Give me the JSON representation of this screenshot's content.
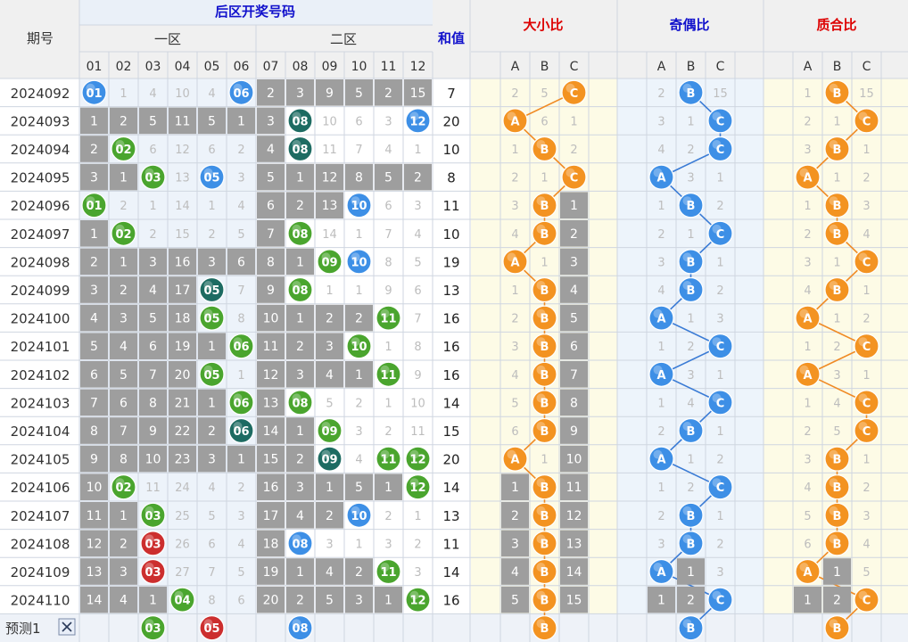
{
  "header": {
    "period_label": "期号",
    "back_zone_title": "后区开奖号码",
    "zone1_label": "一区",
    "zone2_label": "二区",
    "sum_label": "和值",
    "ratio_titles": [
      "大小比",
      "奇偶比",
      "质合比"
    ],
    "columns": [
      "01",
      "02",
      "03",
      "04",
      "05",
      "06",
      "07",
      "08",
      "09",
      "10",
      "11",
      "12"
    ],
    "ratio_sub": [
      "A",
      "B",
      "C"
    ]
  },
  "predict": {
    "label": "预测1",
    "close_icon": "close-x-icon",
    "balls": [
      {
        "col": 3,
        "text": "03",
        "color": "green"
      },
      {
        "col": 5,
        "text": "05",
        "color": "red"
      },
      {
        "col": 8,
        "text": "08",
        "color": "blue"
      }
    ],
    "ratio_balls": [
      {
        "group": 0,
        "col": "B"
      },
      {
        "group": 1,
        "col": "B"
      },
      {
        "group": 2,
        "col": "B"
      }
    ]
  },
  "colors": {
    "blue_ball": "#3d8fe6",
    "green_ball": "#4aa52e",
    "teal_ball": "#1d6b62",
    "red_ball": "#cc2e2e",
    "orange_ball": "#f39321",
    "gray_cell": "#9e9e9e",
    "line_blue": "#3a7bd5",
    "line_orange": "#f08a24"
  },
  "chart_data": {
    "type": "table",
    "rows": [
      {
        "period": "2024092",
        "cells": [
          "01",
          "1",
          "4",
          "10",
          "4",
          "06",
          "2",
          "3",
          "9",
          "5",
          "2",
          "15"
        ],
        "sum": "7",
        "ratios": [
          [
            "2",
            "5",
            "C"
          ],
          [
            "2",
            "B",
            "15"
          ],
          [
            "1",
            "B",
            "15"
          ]
        ]
      },
      {
        "period": "2024093",
        "cells": [
          "1",
          "2",
          "5",
          "11",
          "5",
          "1",
          "3",
          "08",
          "10",
          "6",
          "3",
          "12"
        ],
        "sum": "20",
        "ratios": [
          [
            "A",
            "6",
            "1"
          ],
          [
            "3",
            "1",
            "C"
          ],
          [
            "2",
            "1",
            "C"
          ]
        ]
      },
      {
        "period": "2024094",
        "cells": [
          "2",
          "02",
          "6",
          "12",
          "6",
          "2",
          "4",
          "08",
          "11",
          "7",
          "4",
          "1"
        ],
        "sum": "10",
        "ratios": [
          [
            "1",
            "B",
            "2"
          ],
          [
            "4",
            "2",
            "C"
          ],
          [
            "3",
            "B",
            "1"
          ]
        ]
      },
      {
        "period": "2024095",
        "cells": [
          "3",
          "1",
          "03",
          "13",
          "05",
          "3",
          "5",
          "1",
          "12",
          "8",
          "5",
          "2"
        ],
        "sum": "8",
        "ratios": [
          [
            "2",
            "1",
            "C"
          ],
          [
            "A",
            "3",
            "1"
          ],
          [
            "A",
            "1",
            "2"
          ]
        ]
      },
      {
        "period": "2024096",
        "cells": [
          "01",
          "2",
          "1",
          "14",
          "1",
          "4",
          "6",
          "2",
          "13",
          "10",
          "6",
          "3"
        ],
        "sum": "11",
        "ratios": [
          [
            "3",
            "B",
            "1"
          ],
          [
            "1",
            "B",
            "2"
          ],
          [
            "1",
            "B",
            "3"
          ]
        ]
      },
      {
        "period": "2024097",
        "cells": [
          "1",
          "02",
          "2",
          "15",
          "2",
          "5",
          "7",
          "08",
          "14",
          "1",
          "7",
          "4"
        ],
        "sum": "10",
        "ratios": [
          [
            "4",
            "B",
            "2"
          ],
          [
            "2",
            "1",
            "C"
          ],
          [
            "2",
            "B",
            "4"
          ]
        ]
      },
      {
        "period": "2024098",
        "cells": [
          "2",
          "1",
          "3",
          "16",
          "3",
          "6",
          "8",
          "1",
          "09",
          "10",
          "8",
          "5"
        ],
        "sum": "19",
        "ratios": [
          [
            "A",
            "1",
            "3"
          ],
          [
            "3",
            "B",
            "1"
          ],
          [
            "3",
            "1",
            "C"
          ]
        ]
      },
      {
        "period": "2024099",
        "cells": [
          "3",
          "2",
          "4",
          "17",
          "05",
          "7",
          "9",
          "08",
          "1",
          "1",
          "9",
          "6"
        ],
        "sum": "13",
        "ratios": [
          [
            "1",
            "B",
            "4"
          ],
          [
            "4",
            "B",
            "2"
          ],
          [
            "4",
            "B",
            "1"
          ]
        ]
      },
      {
        "period": "2024100",
        "cells": [
          "4",
          "3",
          "5",
          "18",
          "05",
          "8",
          "10",
          "1",
          "2",
          "2",
          "11",
          "7"
        ],
        "sum": "16",
        "ratios": [
          [
            "2",
            "B",
            "5"
          ],
          [
            "A",
            "1",
            "3"
          ],
          [
            "A",
            "1",
            "2"
          ]
        ]
      },
      {
        "period": "2024101",
        "cells": [
          "5",
          "4",
          "6",
          "19",
          "1",
          "06",
          "11",
          "2",
          "3",
          "10",
          "1",
          "8"
        ],
        "sum": "16",
        "ratios": [
          [
            "3",
            "B",
            "6"
          ],
          [
            "1",
            "2",
            "C"
          ],
          [
            "1",
            "2",
            "C"
          ]
        ]
      },
      {
        "period": "2024102",
        "cells": [
          "6",
          "5",
          "7",
          "20",
          "05",
          "1",
          "12",
          "3",
          "4",
          "1",
          "11",
          "9"
        ],
        "sum": "16",
        "ratios": [
          [
            "4",
            "B",
            "7"
          ],
          [
            "A",
            "3",
            "1"
          ],
          [
            "A",
            "3",
            "1"
          ]
        ]
      },
      {
        "period": "2024103",
        "cells": [
          "7",
          "6",
          "8",
          "21",
          "1",
          "06",
          "13",
          "08",
          "5",
          "2",
          "1",
          "10"
        ],
        "sum": "14",
        "ratios": [
          [
            "5",
            "B",
            "8"
          ],
          [
            "1",
            "4",
            "C"
          ],
          [
            "1",
            "4",
            "C"
          ]
        ]
      },
      {
        "period": "2024104",
        "cells": [
          "8",
          "7",
          "9",
          "22",
          "2",
          "06",
          "14",
          "1",
          "09",
          "3",
          "2",
          "11"
        ],
        "sum": "15",
        "ratios": [
          [
            "6",
            "B",
            "9"
          ],
          [
            "2",
            "B",
            "1"
          ],
          [
            "2",
            "5",
            "C"
          ]
        ]
      },
      {
        "period": "2024105",
        "cells": [
          "9",
          "8",
          "10",
          "23",
          "3",
          "1",
          "15",
          "2",
          "09",
          "4",
          "11",
          "12"
        ],
        "sum": "20",
        "ratios": [
          [
            "A",
            "1",
            "10"
          ],
          [
            "A",
            "1",
            "2"
          ],
          [
            "3",
            "B",
            "1"
          ]
        ]
      },
      {
        "period": "2024106",
        "cells": [
          "10",
          "02",
          "11",
          "24",
          "4",
          "2",
          "16",
          "3",
          "1",
          "5",
          "1",
          "12"
        ],
        "sum": "14",
        "ratios": [
          [
            "1",
            "B",
            "11"
          ],
          [
            "1",
            "2",
            "C"
          ],
          [
            "4",
            "B",
            "2"
          ]
        ]
      },
      {
        "period": "2024107",
        "cells": [
          "11",
          "1",
          "03",
          "25",
          "5",
          "3",
          "17",
          "4",
          "2",
          "10",
          "2",
          "1"
        ],
        "sum": "13",
        "ratios": [
          [
            "2",
            "B",
            "12"
          ],
          [
            "2",
            "B",
            "1"
          ],
          [
            "5",
            "B",
            "3"
          ]
        ]
      },
      {
        "period": "2024108",
        "cells": [
          "12",
          "2",
          "03",
          "26",
          "6",
          "4",
          "18",
          "08",
          "3",
          "1",
          "3",
          "2"
        ],
        "sum": "11",
        "ratios": [
          [
            "3",
            "B",
            "13"
          ],
          [
            "3",
            "B",
            "2"
          ],
          [
            "6",
            "B",
            "4"
          ]
        ]
      },
      {
        "period": "2024109",
        "cells": [
          "13",
          "3",
          "03",
          "27",
          "7",
          "5",
          "19",
          "1",
          "4",
          "2",
          "11",
          "3"
        ],
        "sum": "14",
        "ratios": [
          [
            "4",
            "B",
            "14"
          ],
          [
            "A",
            "1",
            "3"
          ],
          [
            "A",
            "1",
            "5"
          ]
        ]
      },
      {
        "period": "2024110",
        "cells": [
          "14",
          "4",
          "1",
          "04",
          "8",
          "6",
          "20",
          "2",
          "5",
          "3",
          "1",
          "12"
        ],
        "sum": "16",
        "ratios": [
          [
            "5",
            "B",
            "15"
          ],
          [
            "1",
            "2",
            "C"
          ],
          [
            "1",
            "2",
            "C"
          ]
        ]
      }
    ],
    "ball_colors": {
      "0-0": "blue",
      "0-5": "blue",
      "1-7": "teal",
      "1-11": "blue",
      "2-1": "green",
      "2-7": "teal",
      "3-2": "green",
      "3-4": "blue",
      "4-0": "green",
      "4-9": "blue",
      "5-1": "green",
      "5-7": "green",
      "6-8": "green",
      "6-9": "blue",
      "7-4": "teal",
      "7-7": "green",
      "8-4": "green",
      "8-10": "green",
      "9-5": "green",
      "9-9": "green",
      "10-4": "green",
      "10-10": "green",
      "11-5": "green",
      "11-7": "green",
      "12-5": "teal",
      "12-8": "green",
      "13-8": "teal",
      "13-10": "green",
      "13-11": "green",
      "14-1": "green",
      "14-11": "green",
      "15-2": "green",
      "15-9": "blue",
      "16-2": "red",
      "16-7": "blue",
      "17-2": "red",
      "17-10": "green",
      "18-3": "green",
      "18-11": "green"
    }
  }
}
